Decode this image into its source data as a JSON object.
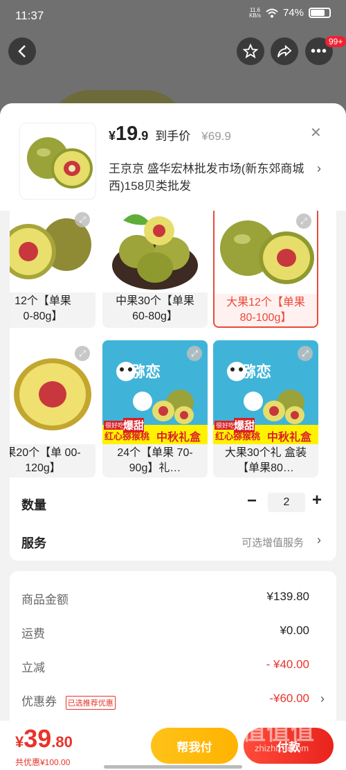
{
  "status": {
    "time": "11:37",
    "net_speed": "11.6",
    "net_unit": "KB/s",
    "battery": "74%"
  },
  "nav": {
    "more_badge": "99+"
  },
  "product": {
    "yen": "¥",
    "price_int": "19",
    "price_dec": ".9",
    "price_tag": "到手价",
    "orig_price": "¥69.9",
    "shop": "王京京  盛华宏林批发市场(新东郊商城西)158贝类批发"
  },
  "options": [
    {
      "label": "12个【单果\n0-80g】",
      "selected": false
    },
    {
      "label": "中果30个【单果\n60-80g】",
      "selected": false
    },
    {
      "label": "大果12个【单果\n80-100g】",
      "selected": true
    },
    {
      "label": "果20个【单\n00-120g】",
      "selected": false
    },
    {
      "label": "24个【单果\n70-90g】礼…",
      "selected": false
    },
    {
      "label": "大果30个礼\n盒装【单果80…",
      "selected": false
    }
  ],
  "gift_box": {
    "brand": "猕恋",
    "small": "很好吃",
    "big": "爆甜",
    "line": "红心猕猴桃",
    "tag": "中秋礼盒"
  },
  "quantity": {
    "label": "数量",
    "value": "2",
    "minus": "−",
    "plus": "+"
  },
  "service": {
    "label": "服务",
    "link": "可选增值服务"
  },
  "summary": {
    "goods_label": "商品金额",
    "goods_value": "¥139.80",
    "ship_label": "运费",
    "ship_value": "¥0.00",
    "discount_label": "立减",
    "discount_value": "- ¥40.00",
    "coupon_label": "优惠券",
    "coupon_tag": "已选推荐优惠",
    "coupon_value": "-¥60.00"
  },
  "bottom": {
    "yen": "¥",
    "final_int": "39",
    "final_dec": ".80",
    "saved": "共优惠¥100.00",
    "help_pay": "帮我付",
    "pay": "付款"
  },
  "watermark": {
    "text": "值值值",
    "url": "zhizhizhi.com"
  },
  "colors": {
    "accent": "#e8332a",
    "help_btn": "#ffb300",
    "selected_bg": "#fff1ef"
  }
}
